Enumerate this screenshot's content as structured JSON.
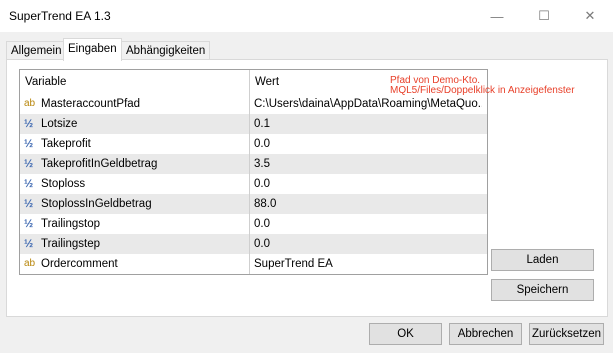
{
  "window": {
    "title": "SuperTrend EA 1.3",
    "min_icon": "minimize-icon",
    "max_icon": "maximize-icon",
    "close_icon": "close-icon"
  },
  "tabs": [
    {
      "label": "Allgemein",
      "active": false
    },
    {
      "label": "Eingaben",
      "active": true
    },
    {
      "label": "Abhängigkeiten",
      "active": false
    }
  ],
  "grid": {
    "headers": {
      "variable": "Variable",
      "value": "Wert"
    },
    "rows": [
      {
        "icon": "ab",
        "name": "MasteraccountPfad",
        "value": "C:\\Users\\daina\\AppData\\Roaming\\MetaQuo..."
      },
      {
        "icon": "½",
        "name": "Lotsize",
        "value": "0.1"
      },
      {
        "icon": "½",
        "name": "Takeprofit",
        "value": "0.0"
      },
      {
        "icon": "½",
        "name": "TakeprofitInGeldbetrag",
        "value": "3.5"
      },
      {
        "icon": "½",
        "name": "Stoploss",
        "value": "0.0"
      },
      {
        "icon": "½",
        "name": "StoplossInGeldbetrag",
        "value": "88.0"
      },
      {
        "icon": "½",
        "name": "Trailingstop",
        "value": "0.0"
      },
      {
        "icon": "½",
        "name": "Trailingstep",
        "value": "0.0"
      },
      {
        "icon": "ab",
        "name": "Ordercomment",
        "value": "SuperTrend EA"
      }
    ]
  },
  "annotation": {
    "line1": "Pfad von Demo-Kto.",
    "line2": "MQL5/Files/Doppelklick in Anzeigefenster",
    "color": "#e8402a"
  },
  "side_buttons": {
    "load": "Laden",
    "save": "Speichern"
  },
  "footer_buttons": {
    "ok": "OK",
    "cancel": "Abbrechen",
    "reset": "Zurücksetzen"
  }
}
